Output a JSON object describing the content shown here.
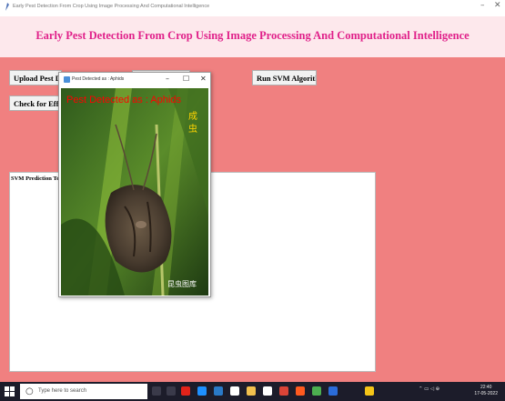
{
  "window": {
    "title": "Early Pest Detection From Crop Using Image Processing And Computational Intelligence",
    "minimize": "–",
    "close": "✕"
  },
  "banner": {
    "heading": "Early Pest Detection From Crop Using Image Processing And Computational Intelligence"
  },
  "buttons": {
    "upload": "Upload Pest Dat",
    "run_svm": "Run SVM Algorithm",
    "check": "Check for Effect"
  },
  "prediction": {
    "label": "SVM Prediction Te"
  },
  "popup": {
    "title": "Pest Detected as : Aphids",
    "overlay_text": "Pest Detected as : Aphids",
    "minimize": "–",
    "maximize": "☐",
    "close": "✕"
  },
  "taskbar": {
    "search_placeholder": "Type here to search",
    "time": "22:40",
    "date": "17-05-2022"
  },
  "colors": {
    "background": "#f08080",
    "heading": "#e0218a",
    "banner": "#fde8ec",
    "overlay_text": "#ff0000"
  }
}
